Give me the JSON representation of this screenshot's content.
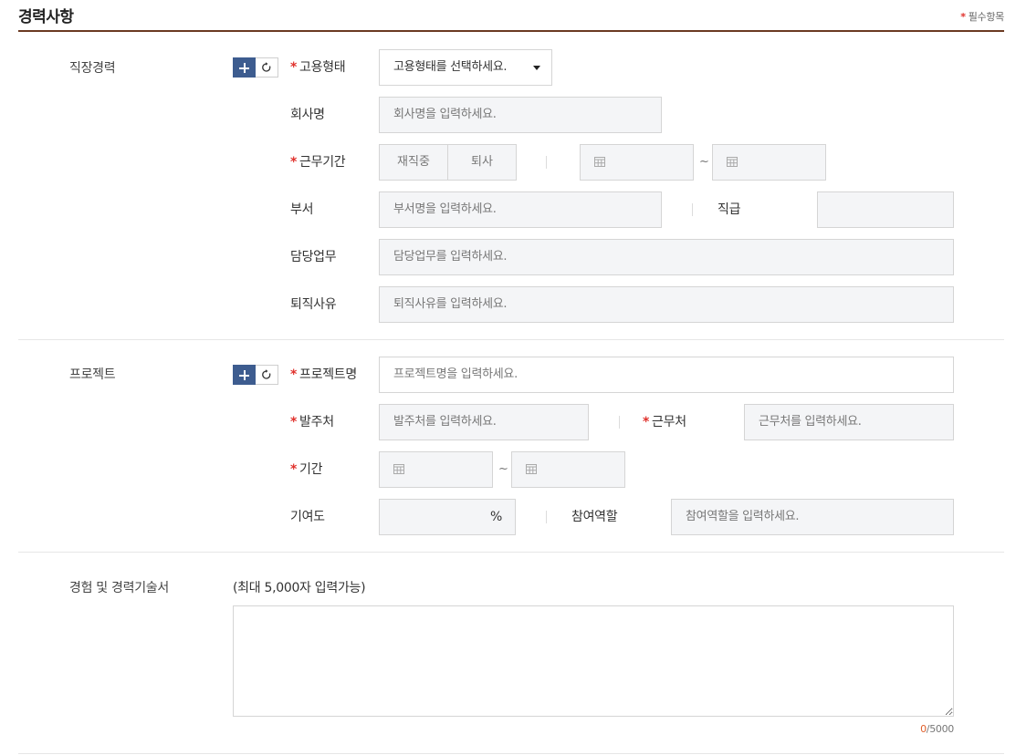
{
  "section": {
    "title": "경력사항",
    "required_note": "필수항목",
    "required_mark": "*"
  },
  "work": {
    "label": "직장경력",
    "employment_type": {
      "label": "고용형태",
      "value": "고용형태를 선택하세요."
    },
    "company": {
      "label": "회사명",
      "placeholder": "회사명을 입력하세요."
    },
    "period": {
      "label": "근무기간",
      "options": [
        "재직중",
        "퇴사"
      ],
      "tilde": "~"
    },
    "department": {
      "label": "부서",
      "placeholder": "부서명을 입력하세요."
    },
    "position": {
      "label": "직급",
      "placeholder": ""
    },
    "duties": {
      "label": "담당업무",
      "placeholder": "담당업무를 입력하세요."
    },
    "resign_reason": {
      "label": "퇴직사유",
      "placeholder": "퇴직사유를 입력하세요."
    }
  },
  "project": {
    "label": "프로젝트",
    "name": {
      "label": "프로젝트명",
      "placeholder": "프로젝트명을 입력하세요."
    },
    "client": {
      "label": "발주처",
      "placeholder": "발주처를 입력하세요."
    },
    "workplace": {
      "label": "근무처",
      "placeholder": "근무처를 입력하세요."
    },
    "period": {
      "label": "기간",
      "tilde": "~"
    },
    "contribution": {
      "label": "기여도",
      "unit": "%"
    },
    "role": {
      "label": "참여역할",
      "placeholder": "참여역할을 입력하세요."
    }
  },
  "statement": {
    "label": "경험 및 경력기술서",
    "hint": "(최대 5,000자 입력가능)",
    "count_current": "0",
    "count_max": "/5000"
  },
  "colors": {
    "accent_line": "#6b3a22",
    "add_button": "#3d5c8f",
    "required": "#e0312c"
  }
}
